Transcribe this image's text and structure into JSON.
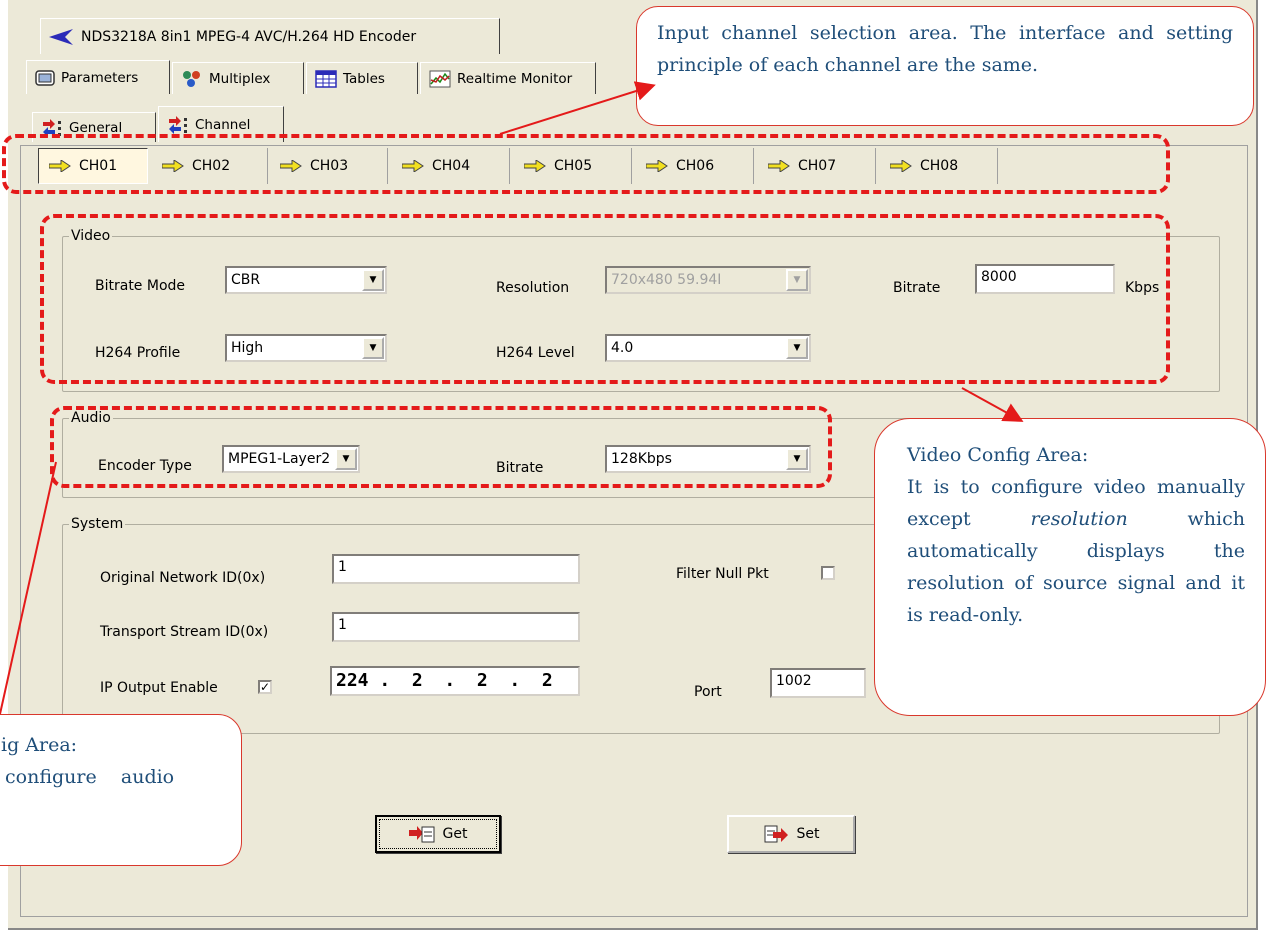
{
  "window": {
    "title": "NDS3218A 8in1 MPEG-4 AVC/H.264 HD Encoder"
  },
  "main_tabs": [
    "Parameters",
    "Multiplex",
    "Tables",
    "Realtime Monitor"
  ],
  "sub_tabs": [
    "General",
    "Channel"
  ],
  "channels": [
    "CH01",
    "CH02",
    "CH03",
    "CH04",
    "CH05",
    "CH06",
    "CH07",
    "CH08"
  ],
  "video": {
    "legend": "Video",
    "bitrate_mode_label": "Bitrate Mode",
    "bitrate_mode_value": "CBR",
    "resolution_label": "Resolution",
    "resolution_value": "720x480 59.94I",
    "bitrate_label": "Bitrate",
    "bitrate_value": "8000",
    "bitrate_unit": "Kbps",
    "profile_label": "H264 Profile",
    "profile_value": "High",
    "level_label": "H264 Level",
    "level_value": "4.0"
  },
  "audio": {
    "legend": "Audio",
    "encoder_type_label": "Encoder Type",
    "encoder_type_value": "MPEG1-Layer2",
    "bitrate_label": "Bitrate",
    "bitrate_value": "128Kbps"
  },
  "system": {
    "legend": "System",
    "onid_label": "Original Network ID(0x)",
    "onid_value": "1",
    "tsid_label": "Transport Stream ID(0x)",
    "tsid_value": "1",
    "ip_enable_label": "IP Output Enable",
    "ip_value": "224 .  2  .  2  .  2",
    "filter_null_label": "Filter Null Pkt",
    "port_label": "Port",
    "port_value": "1002"
  },
  "buttons": {
    "get": "Get",
    "set": "Set"
  },
  "callouts": {
    "channel_area": "Input channel selection area. The interface and setting principle of each channel are the same.",
    "video_title": "Video Config Area:",
    "video_body_1": "It is to configure video manually except ",
    "video_body_em": "resolution",
    "video_body_2": " which automatically displays the resolution of source signal and it is read-only.",
    "audio_title": "ig Area:",
    "audio_body": "configure    audio"
  },
  "colors": {
    "annotation_red": "#e41a1a",
    "callout_text": "#1f4e79",
    "window_bg": "#ece9d8"
  }
}
